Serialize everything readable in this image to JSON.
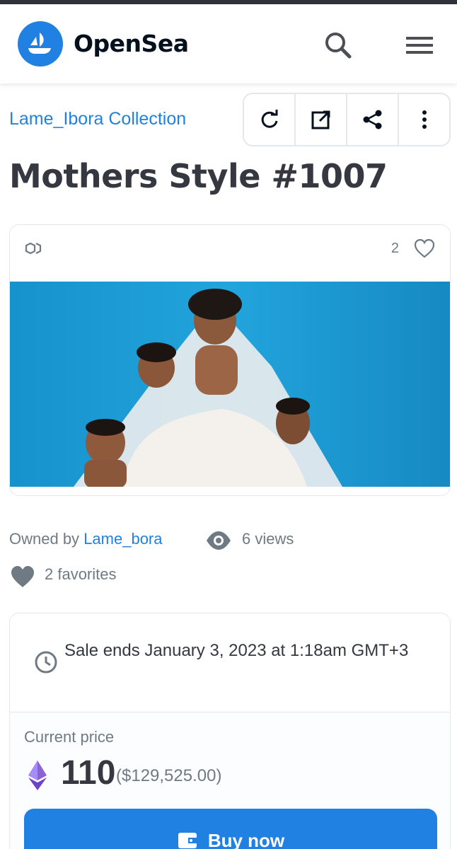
{
  "header": {
    "brand": "OpenSea",
    "icons": [
      "opensea-logo-icon",
      "search-icon",
      "menu-icon"
    ]
  },
  "item": {
    "collection": "Lame_Ibora Collection",
    "title": "Mothers Style #1007",
    "favorites_count": "2",
    "owned_by_label": "Owned by",
    "owner": "Lame_bora",
    "views": "6 views",
    "favorites": "2 favorites"
  },
  "actions": [
    "refresh-icon",
    "external-link-icon",
    "share-icon",
    "more-icon"
  ],
  "sale": {
    "ends_text": "Sale ends January 3, 2023 at 1:18am GMT+3",
    "price_label": "Current price",
    "price": "110",
    "price_usd": "($129,525.00)",
    "buy_label": "Buy now"
  },
  "colors": {
    "accent": "#2081e2",
    "text": "#353840",
    "muted": "#707a83",
    "image_background": "#1a9bd1"
  }
}
